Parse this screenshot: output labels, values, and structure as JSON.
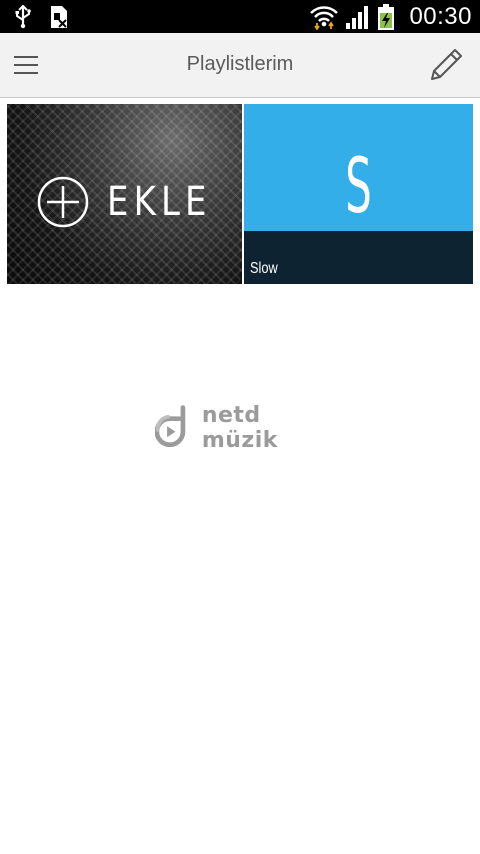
{
  "status_bar": {
    "time": "00:30",
    "icons": [
      "usb-icon",
      "sim-card-icon",
      "wifi-icon",
      "signal-icon",
      "battery-icon"
    ]
  },
  "toolbar": {
    "title": "Playlistlerim",
    "menu_icon": "hamburger-menu-icon",
    "edit_icon": "pencil-icon"
  },
  "tiles": {
    "add": {
      "label": "EKLE",
      "icon": "plus-circle-icon"
    },
    "playlists": [
      {
        "letter": "S",
        "name": "Slow",
        "color": "#33aee8",
        "footer_color": "#0e2331"
      }
    ]
  },
  "logo": {
    "text": "netd müzik"
  }
}
